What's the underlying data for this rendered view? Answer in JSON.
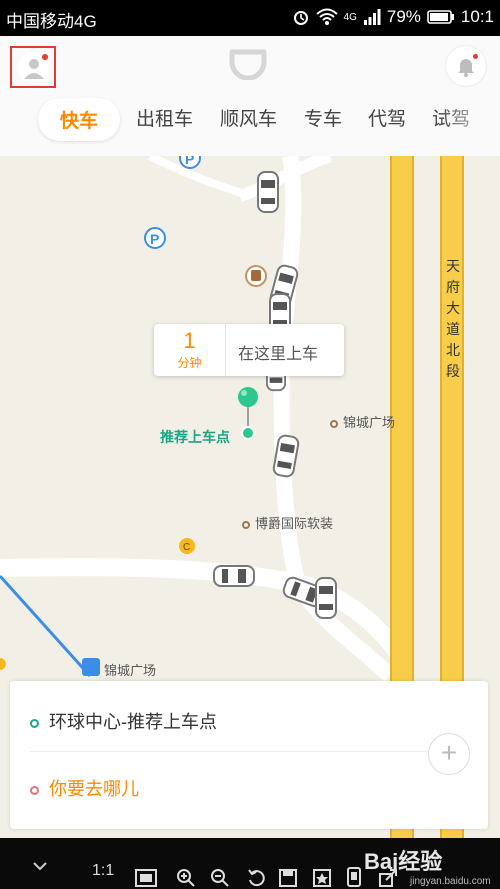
{
  "status": {
    "carrier": "中国移动4G",
    "signal_label": "4G",
    "battery": "79%",
    "time": "10:1"
  },
  "header": {
    "tabs": [
      {
        "label": "快车",
        "active": true
      },
      {
        "label": "出租车",
        "active": false
      },
      {
        "label": "顺风车",
        "active": false
      },
      {
        "label": "专车",
        "active": false
      },
      {
        "label": "代驾",
        "active": false
      },
      {
        "label": "试驾",
        "active": false
      }
    ]
  },
  "map": {
    "eta_value": "1",
    "eta_unit": "分钟",
    "pickup_prompt": "在这里上车",
    "pin_label": "推荐上车点",
    "road_label": "天府大道北段",
    "pois": [
      {
        "name": "锦城广场"
      },
      {
        "name": "博爵国际软装"
      },
      {
        "name": "锦城广场"
      }
    ]
  },
  "card": {
    "from": "环球中心-推荐上车点",
    "to": "你要去哪儿",
    "add_label": "+"
  },
  "toolbar": {
    "zoom_label": "1:1",
    "watermark": "Bai经验",
    "watermark_sub": "jingyan.baidu.com"
  },
  "colors": {
    "accent": "#ff8a00",
    "green": "#1aa687",
    "road_major": "#f7cd4a"
  }
}
